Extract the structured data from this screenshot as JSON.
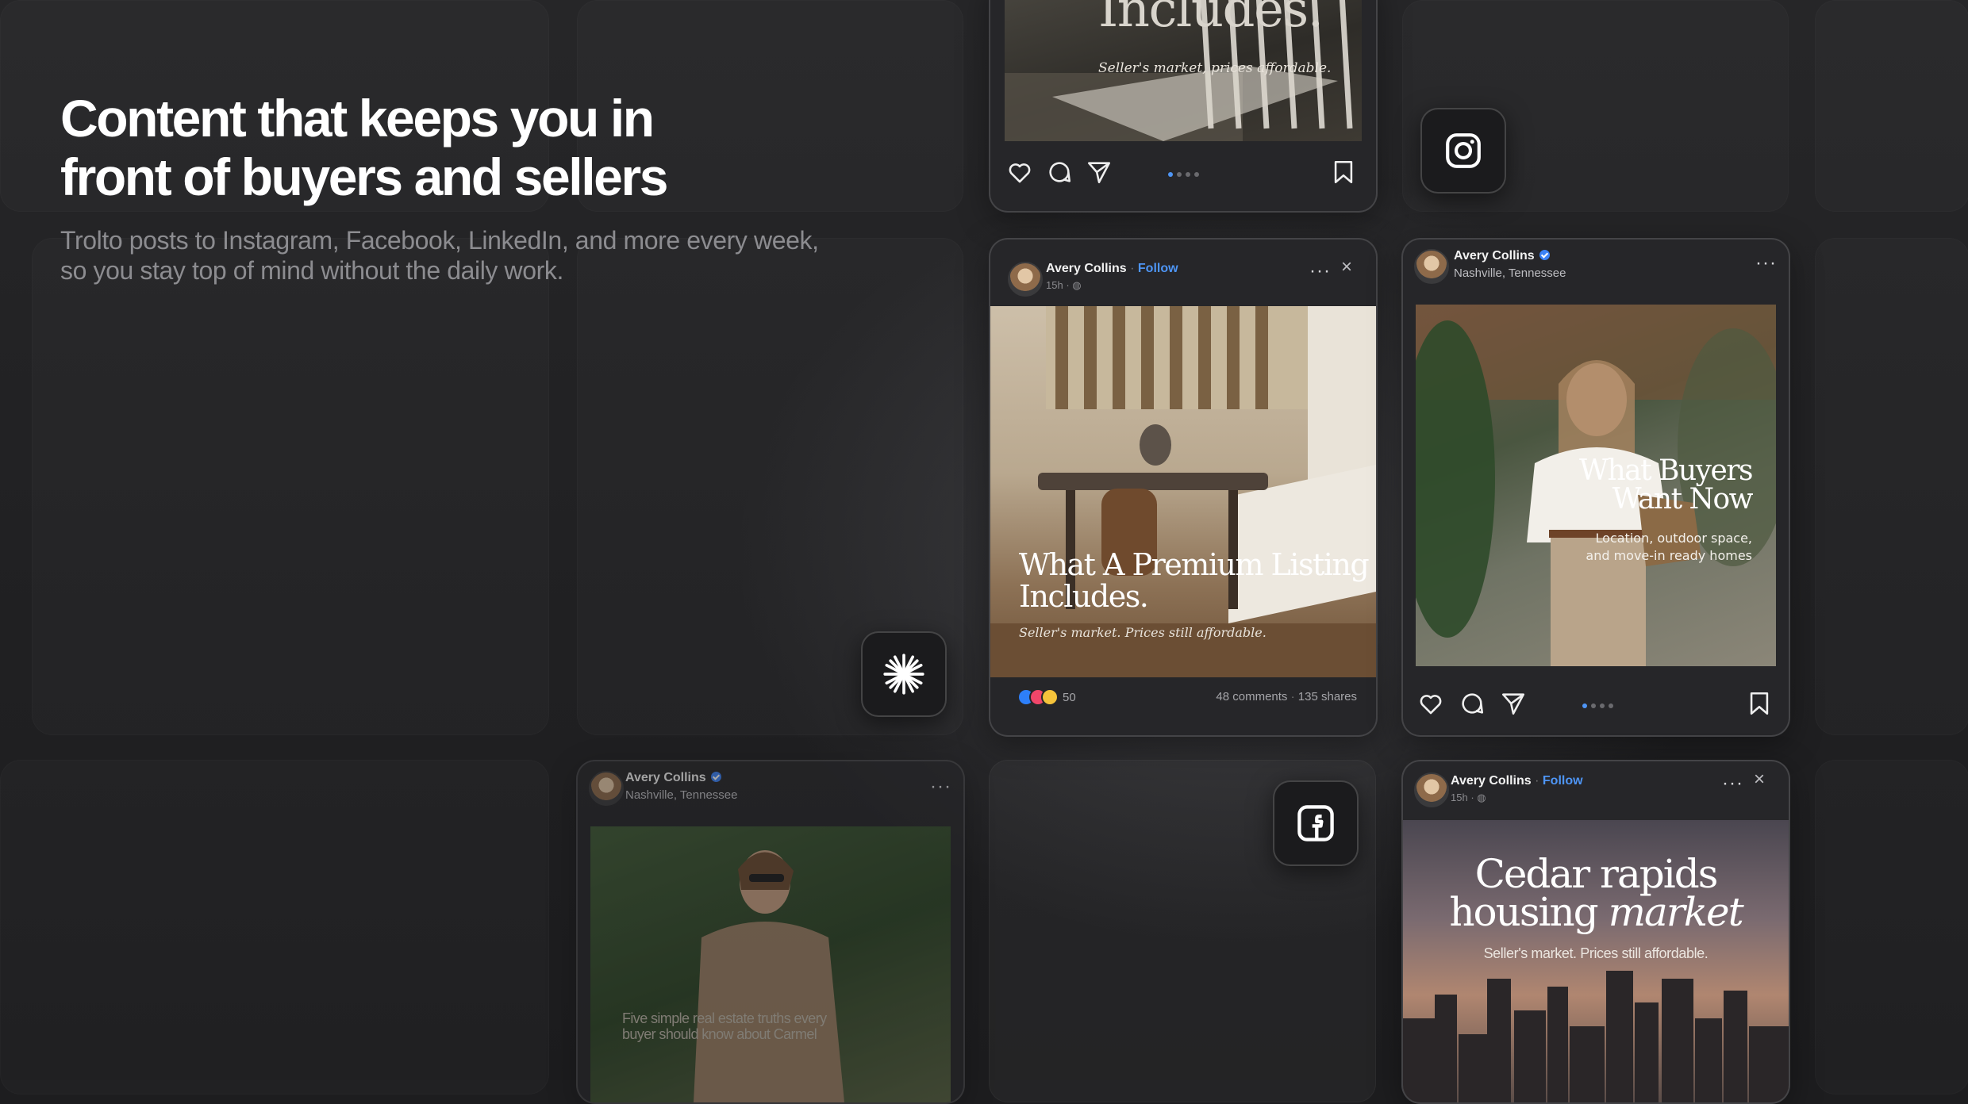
{
  "hero": {
    "title_line1": "Content that keeps you in",
    "title_line2": "front of buyers and sellers",
    "subtitle": "Trolto posts to Instagram, Facebook, LinkedIn, and more every week, so you stay top of mind without the daily work."
  },
  "top_post": {
    "title_fragment": "Includes.",
    "tagline": "Seller's market, prices affordable."
  },
  "facebook_post": {
    "author": "Avery Collins",
    "follow": "Follow",
    "time": "15h",
    "more": "···",
    "close": "×",
    "title": "What A Premium Listing Includes.",
    "tagline": "Seller's market. Prices still affordable.",
    "reaction_count": "50",
    "comments": "48 comments",
    "shares": "135 shares"
  },
  "instagram_post": {
    "author": "Avery Collins",
    "location": "Nashville, Tennessee",
    "more": "···",
    "title_line1": "What Buyers",
    "title_line2": "Want Now",
    "caption_line1": "Location, outdoor space,",
    "caption_line2": "and move-in ready homes"
  },
  "bottom_left_post": {
    "author": "Avery Collins",
    "location": "Nashville, Tennessee",
    "more": "···",
    "caption_line1": "Five simple real estate truths every",
    "caption_line2": "buyer should know about Carmel"
  },
  "bottom_right_post": {
    "author": "Avery Collins",
    "follow": "Follow",
    "time": "15h",
    "more": "···",
    "close": "×",
    "title_line1": "Cedar rapids",
    "title_line2_plain": "housing ",
    "title_line2_italic": "market",
    "tagline": "Seller's market. Prices still affordable."
  },
  "icons": {
    "instagram": "instagram-icon",
    "facebook": "facebook-icon",
    "brand": "asterisk-burst-icon"
  },
  "colors": {
    "background": "#1d1d1f",
    "accent_blue": "#4e95f5",
    "muted_text": "#8c8c90"
  }
}
